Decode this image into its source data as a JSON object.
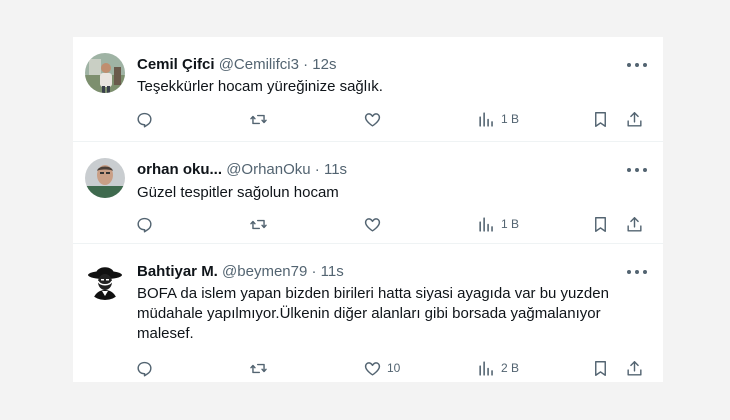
{
  "tweets": [
    {
      "name": "Cemil Çifci",
      "handle": "@Cemilifci3",
      "separator": "·",
      "time": "12s",
      "text": "Teşekkürler hocam yüreğinize sağlık.",
      "replies": "",
      "retweets": "",
      "likes": "",
      "views": "1 B",
      "avatar": "photo-man-outdoors"
    },
    {
      "name": "orhan oku...",
      "handle": "@OrhanOku",
      "separator": "·",
      "time": "11s",
      "text": "Güzel tespitler sağolun hocam",
      "replies": "",
      "retweets": "",
      "likes": "",
      "views": "1 B",
      "avatar": "photo-man-portrait"
    },
    {
      "name": "Bahtiyar M.",
      "handle": "@beymen79",
      "separator": "·",
      "time": "11s",
      "text": "BOFA da islem yapan bizden birileri hatta siyasi ayagıda var bu yuzden müdahale yapılmıyor.Ülkenin diğer alanları gibi borsada yağmalanıyor malesef.",
      "replies": "",
      "retweets": "",
      "likes": "10",
      "views": "2 B",
      "avatar": "cowboy-illustration"
    }
  ],
  "icons": {
    "reply": "reply-icon",
    "retweet": "retweet-icon",
    "like": "heart-icon",
    "views": "views-chart-icon",
    "bookmark": "bookmark-icon",
    "share": "share-icon",
    "more": "more-icon"
  },
  "colors": {
    "background": "#f3f3f3",
    "card": "#ffffff",
    "text": "#0f1419",
    "secondary": "#536471",
    "divider": "#eff3f4"
  }
}
